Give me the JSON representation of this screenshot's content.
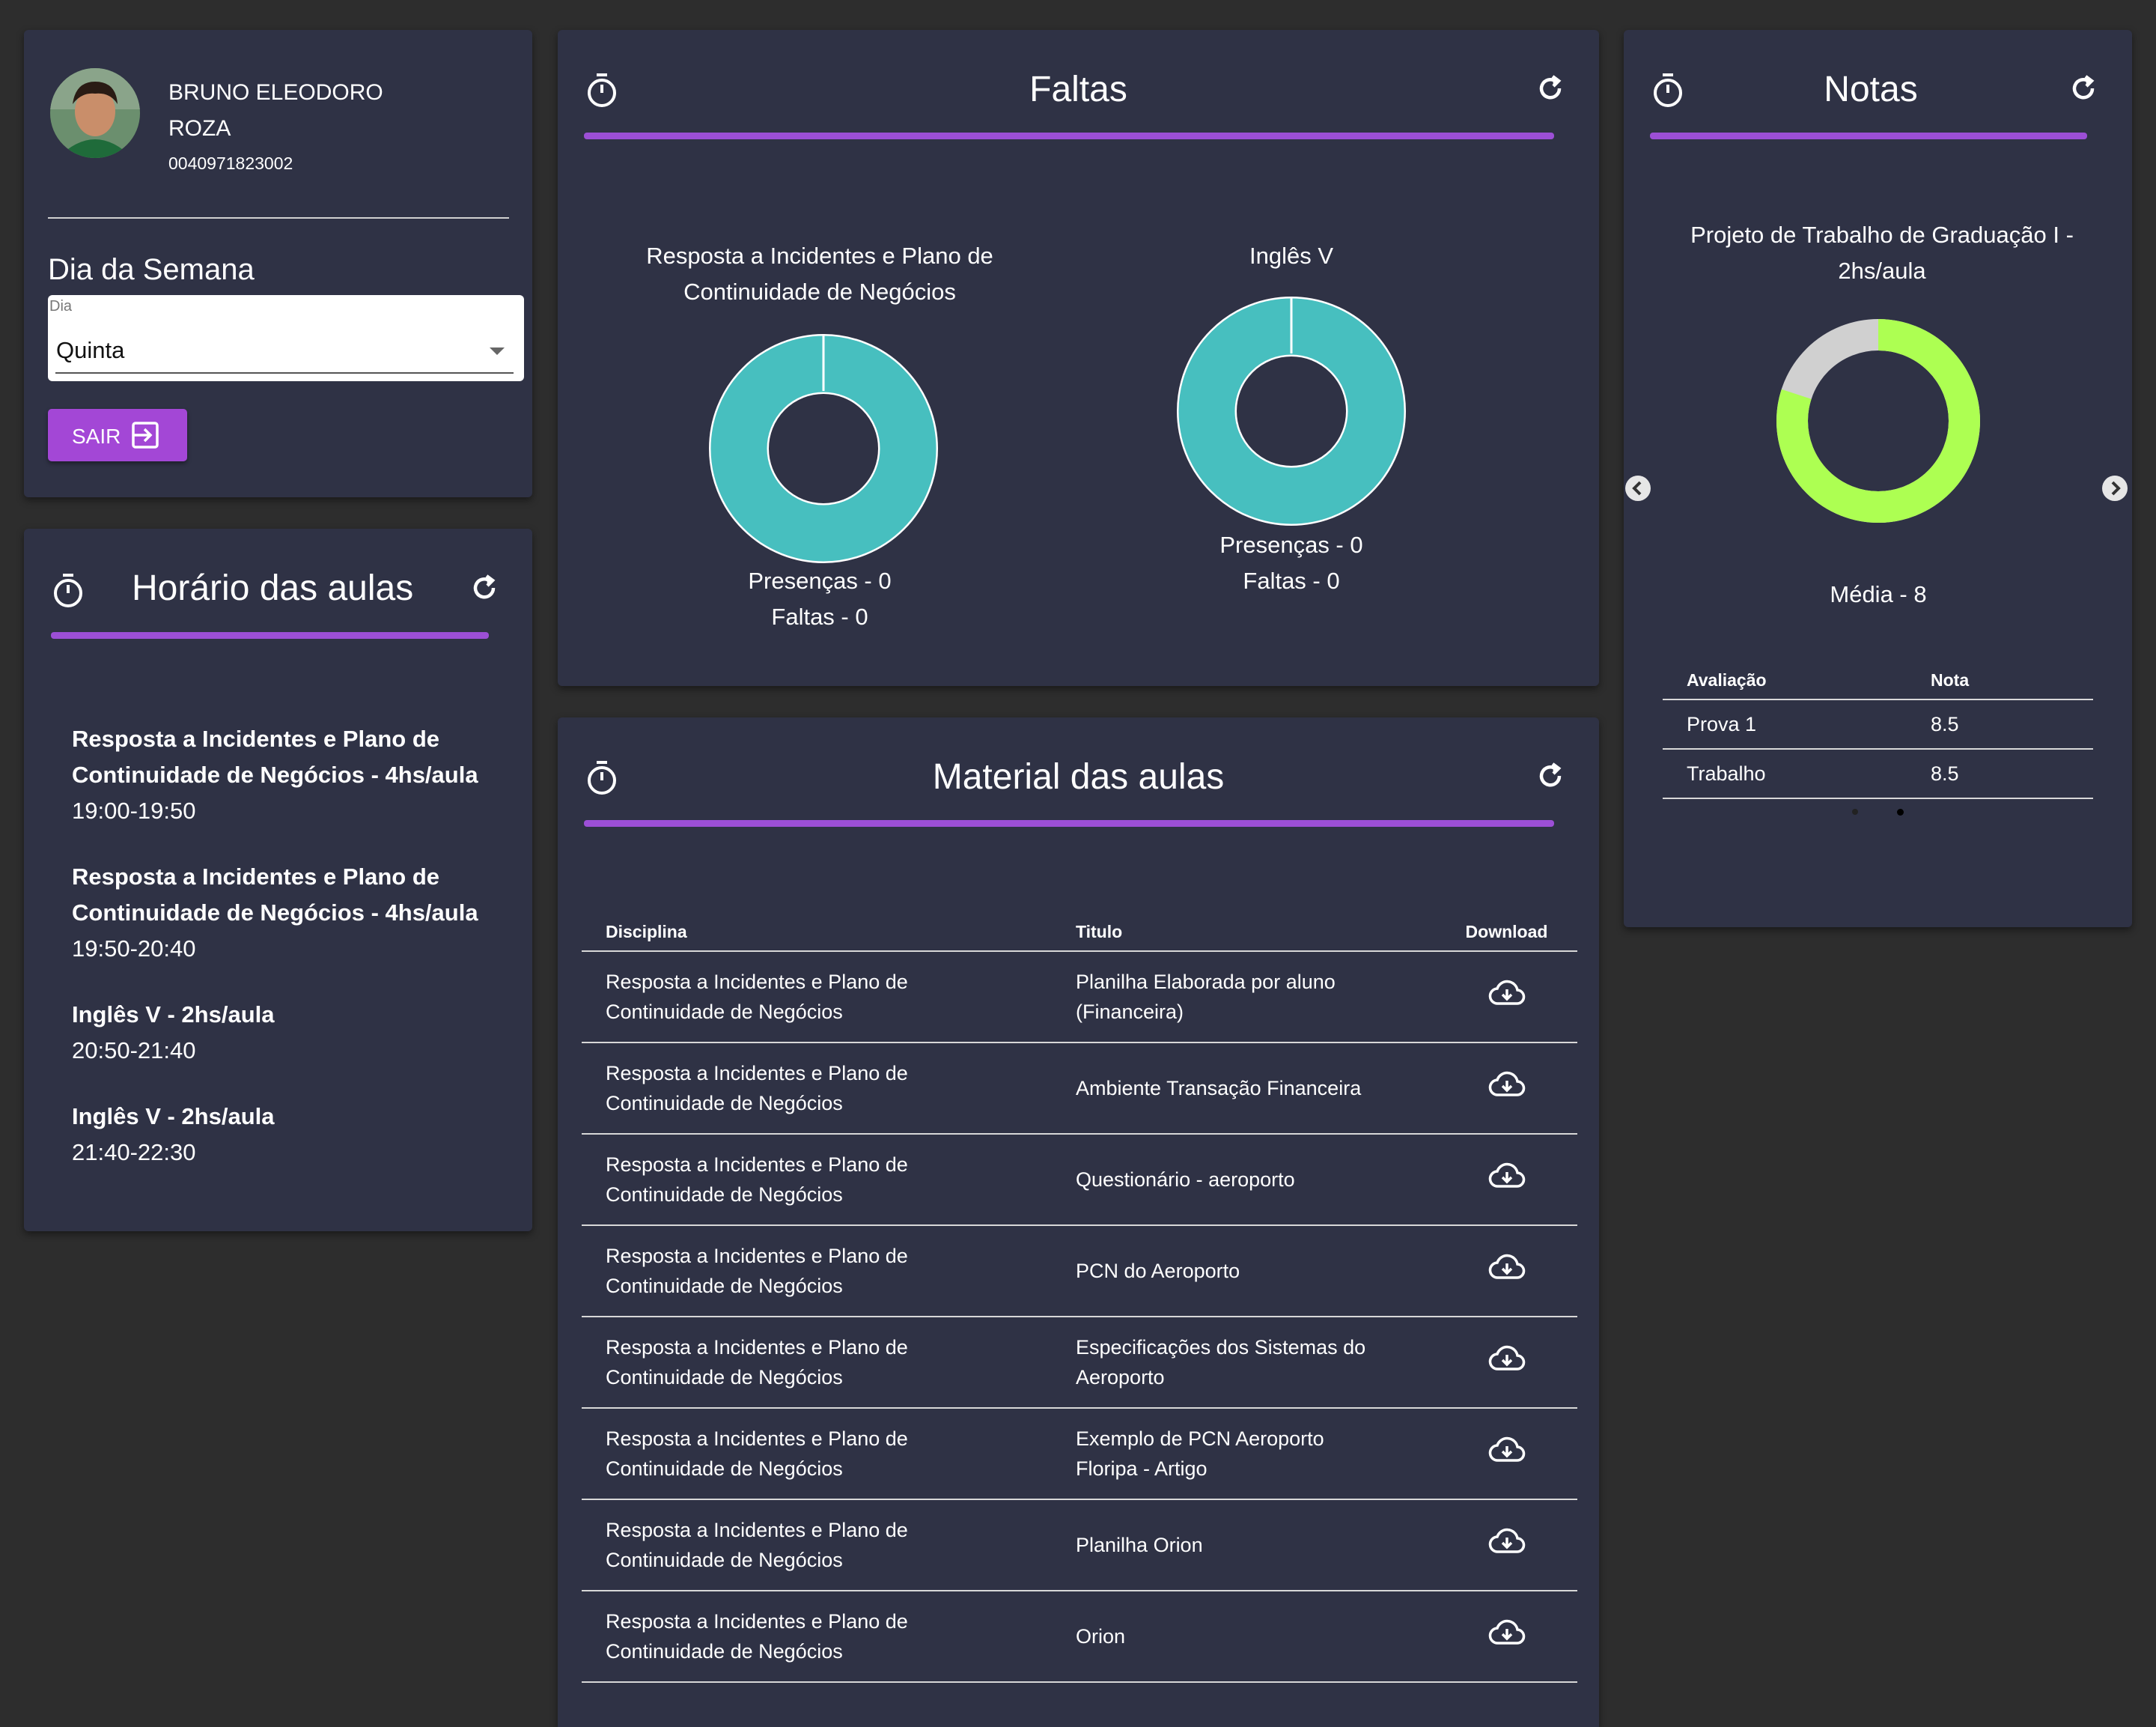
{
  "profile": {
    "name_line1": "BRUNO ELEODORO",
    "name_line2": "ROZA",
    "ra": "0040971823002"
  },
  "weekday": {
    "heading": "Dia da Semana",
    "select_label": "Dia",
    "select_value": "Quinta",
    "logout_label": "SAIR"
  },
  "schedule": {
    "title": "Horário das aulas",
    "items": [
      {
        "title": "Resposta a Incidentes e Plano de Continuidade de Negócios - 4hs/aula",
        "time": "19:00-19:50"
      },
      {
        "title": "Resposta a Incidentes e Plano de Continuidade de Negócios - 4hs/aula",
        "time": "19:50-20:40"
      },
      {
        "title": "Inglês V - 2hs/aula",
        "time": "20:50-21:40"
      },
      {
        "title": "Inglês V - 2hs/aula",
        "time": "21:40-22:30"
      }
    ]
  },
  "absences": {
    "title": "Faltas",
    "charts": [
      {
        "subject": "Resposta a Incidentes e Plano de Continuidade de Negócios",
        "presences_label": "Presenças - 0",
        "absences_label": "Faltas - 0",
        "presences": 0,
        "absences": 0
      },
      {
        "subject": "Inglês V",
        "presences_label": "Presenças - 0",
        "absences_label": "Faltas - 0",
        "presences": 0,
        "absences": 0
      }
    ]
  },
  "grades": {
    "title": "Notas",
    "subject": "Projeto de Trabalho de Graduação I - 2hs/aula",
    "average_label": "Média - 8",
    "average": 8,
    "max": 10,
    "columns": [
      "Avaliação",
      "Nota"
    ],
    "rows": [
      {
        "evaluation": "Prova 1",
        "grade": "8.5"
      },
      {
        "evaluation": "Trabalho",
        "grade": "8.5"
      }
    ],
    "carousel_active": 1,
    "carousel_count": 2
  },
  "materials": {
    "title": "Material das aulas",
    "columns": [
      "Disciplina",
      "Titulo",
      "Download"
    ],
    "rows": [
      {
        "subject": "Resposta a Incidentes e Plano de Continuidade de Negócios",
        "title": "Planilha Elaborada por aluno (Financeira)"
      },
      {
        "subject": "Resposta a Incidentes e Plano de Continuidade de Negócios",
        "title": "Ambiente Transação Financeira"
      },
      {
        "subject": "Resposta a Incidentes e Plano de Continuidade de Negócios",
        "title": "Questionário - aeroporto"
      },
      {
        "subject": "Resposta a Incidentes e Plano de Continuidade de Negócios",
        "title": "PCN do Aeroporto"
      },
      {
        "subject": "Resposta a Incidentes e Plano de Continuidade de Negócios",
        "title": "Especificações dos Sistemas do Aeroporto"
      },
      {
        "subject": "Resposta a Incidentes e Plano de Continuidade de Negócios",
        "title": "Exemplo de PCN Aeroporto Floripa - Artigo"
      },
      {
        "subject": "Resposta a Incidentes e Plano de Continuidade de Negócios",
        "title": "Planilha Orion"
      },
      {
        "subject": "Resposta a Incidentes e Plano de Continuidade de Negócios",
        "title": "Orion"
      }
    ]
  },
  "colors": {
    "background": "#2d2d2d",
    "card": "#2f3245",
    "accent": "#9c4fd6",
    "teal": "#47bfbf",
    "green": "#adff52",
    "grey": "#d0d0d0"
  },
  "icons": [
    "timer-icon",
    "refresh-icon",
    "logout-icon",
    "chevron-left-icon",
    "chevron-right-icon",
    "cloud-download-icon",
    "dropdown-arrow-icon"
  ]
}
